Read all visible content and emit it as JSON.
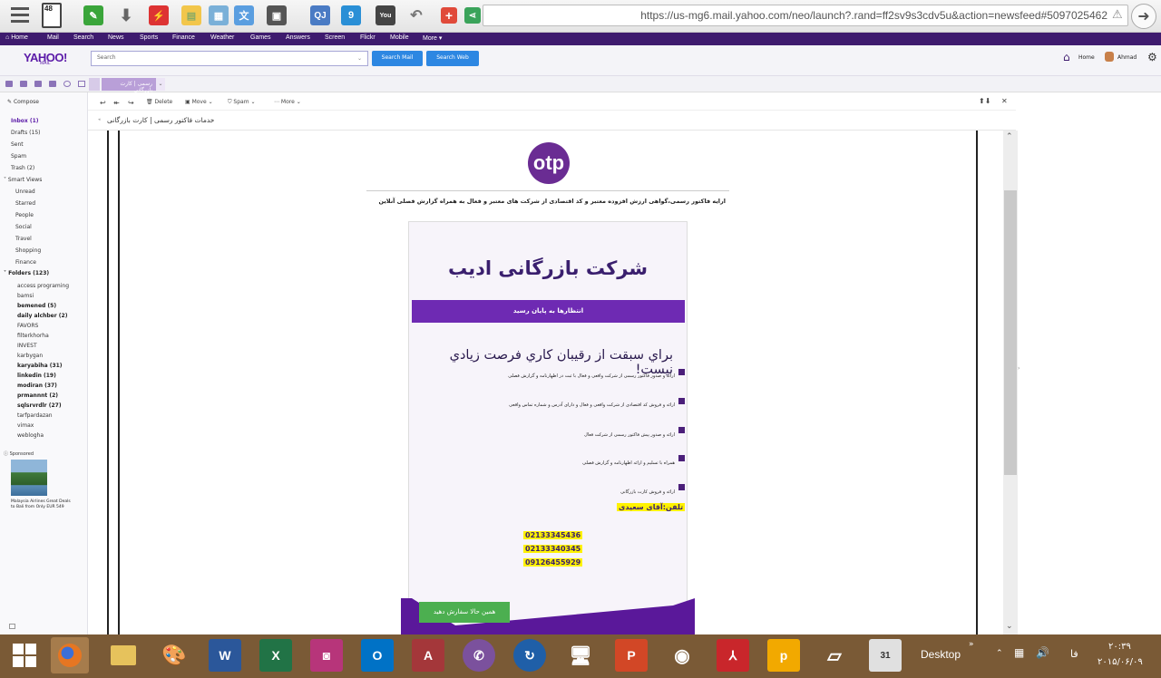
{
  "browser": {
    "tab_count": "48",
    "url": "https://us-mg6.mail.yahoo.com/neo/launch?.rand=ff2sv9s3cdv5u&action=newsfeed#5097025462",
    "extension_labels": [
      "QJ",
      "9"
    ]
  },
  "yahoo_nav": {
    "items": [
      "Home",
      "Mail",
      "Search",
      "News",
      "Sports",
      "Finance",
      "Weather",
      "Games",
      "Answers",
      "Screen",
      "Flickr",
      "Mobile",
      "More ▾"
    ]
  },
  "mail_header": {
    "logo": "YAHOO!",
    "logo_sub": "MAIL",
    "search_placeholder": "Search",
    "search_mail_label": "Search Mail",
    "search_web_label": "Search Web",
    "home_label": "Home",
    "user_name": "Ahmad"
  },
  "tab": {
    "label": "رسمی | کارت بازرگانی"
  },
  "sidebar": {
    "compose_label": "Compose",
    "inbox": "Inbox (1)",
    "drafts": "Drafts (15)",
    "sent": "Sent",
    "spam": "Spam",
    "trash": "Trash (2)",
    "smart_views": "Smart Views",
    "smart_items": [
      "Unread",
      "Starred",
      "People",
      "Social",
      "Travel",
      "Shopping",
      "Finance"
    ],
    "folders": "Folders (123)",
    "folder_items": [
      {
        "name": "access programing",
        "bold": false
      },
      {
        "name": "bamsi",
        "bold": false
      },
      {
        "name": "bemened (5)",
        "bold": true
      },
      {
        "name": "daily alchber (2)",
        "bold": true
      },
      {
        "name": "FAVORS",
        "bold": false
      },
      {
        "name": "filterkhorha",
        "bold": false
      },
      {
        "name": "INVEST",
        "bold": false
      },
      {
        "name": "karbygan",
        "bold": false
      },
      {
        "name": "karyabiha (31)",
        "bold": true
      },
      {
        "name": "linkedin (19)",
        "bold": true
      },
      {
        "name": "modiran (37)",
        "bold": true
      },
      {
        "name": "prmannnt (2)",
        "bold": true
      },
      {
        "name": "sqlsrvrdlr (27)",
        "bold": true
      },
      {
        "name": "tarfpardazan",
        "bold": false
      },
      {
        "name": "vimax",
        "bold": false
      },
      {
        "name": "weblogha",
        "bold": false
      }
    ],
    "sponsored_label": "Sponsored",
    "ad_text": "Malaysia Airlines Great Deals to Bali from Only EUR 549"
  },
  "toolbar": {
    "delete_label": "Delete",
    "move_label": "Move ⌄",
    "spam_label": "Spam ⌄",
    "more_label": "More ⌄"
  },
  "message": {
    "subject": "خدمات فاکتور رسمی | کارت بازرگانی",
    "logo_text": "otp",
    "intro": "ارایه فاکتور رسمی،گواهی ارزش افزوده معتبر و کد اقتصادی از شرکت های معتبر و فعال به همراه گزارش فصلی آنلاین",
    "company": "شرکت بازرگانی ادیب",
    "banner": "انتظارها به پایان رسید",
    "headline": "براي سبقت از رقيبان كاري فرصت زيادي نيست!",
    "bullets": [
      "ارائه و صدور فاکتور رسمی از شرکت واقعی و فعال با ثبت در اظهارنامه و گزارش فصلی",
      "ارائه و فروش کد اقتصادی از شرکت واقعی و فعال و دارای آدرس و شماره تماس واقعی",
      "ارائه و صدور پیش فاکتور رسمی از شرکت فعال",
      "همراه با تسلیم و ارائه اظهارنامه و گزارش فصلی",
      "ارائه و فروش کارت بازرگانی"
    ],
    "contact_label": "تلفن:آقای سعیدی",
    "phones": [
      "02133345436",
      "02133340345",
      "09126455929"
    ],
    "order_button": "همین حالا سفارش دهید"
  },
  "taskbar": {
    "apps": [
      "W",
      "X",
      "O",
      "A"
    ],
    "desktop_label": "Desktop",
    "lang": "فا",
    "time": "۲۰:۳۹",
    "date": "۲۰۱۵/۰۶/۰۹"
  }
}
